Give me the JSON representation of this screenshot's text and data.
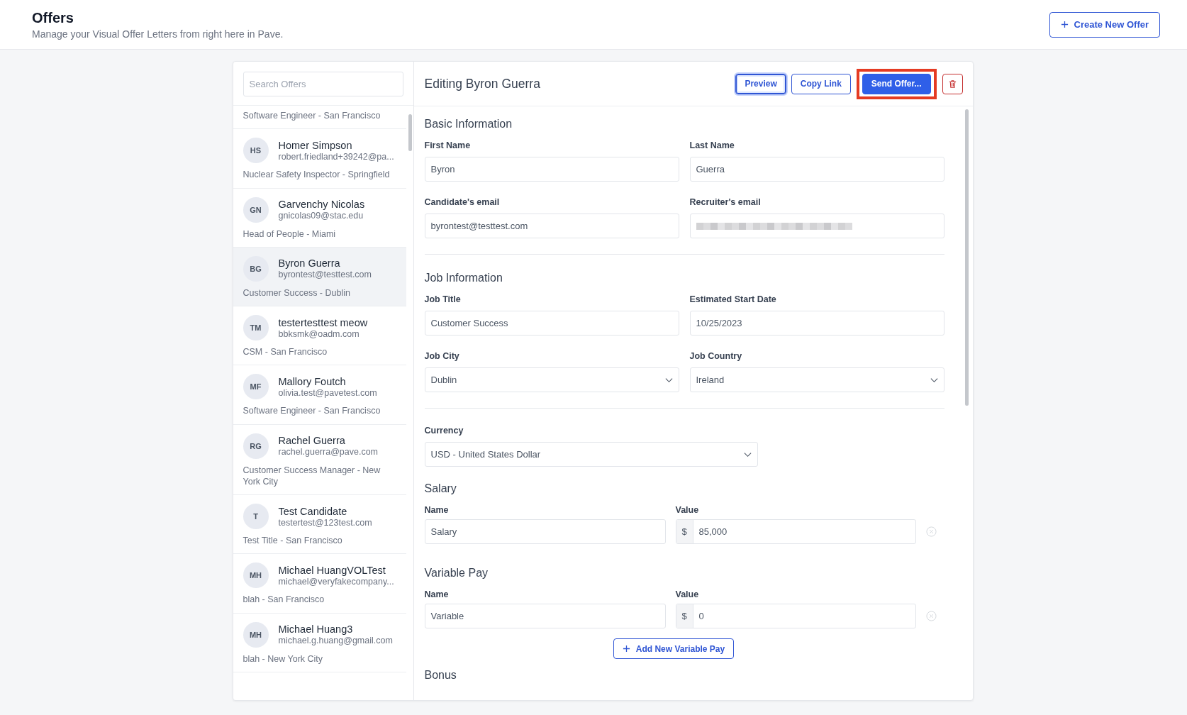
{
  "header": {
    "title": "Offers",
    "subtitle": "Manage your Visual Offer Letters from right here in Pave.",
    "create_button": "Create New Offer"
  },
  "search": {
    "placeholder": "Search Offers"
  },
  "offers": [
    {
      "kind": "partial",
      "role": "Software Engineer - San Francisco",
      "selected": false
    },
    {
      "kind": "full",
      "initials": "HS",
      "name": "Homer Simpson",
      "email": "robert.friedland+39242@pa...",
      "role": "Nuclear Safety Inspector - Springfield",
      "selected": false
    },
    {
      "kind": "full",
      "initials": "GN",
      "name": "Garvenchy Nicolas",
      "email": "gnicolas09@stac.edu",
      "role": "Head of People - Miami",
      "selected": false
    },
    {
      "kind": "full",
      "initials": "BG",
      "name": "Byron Guerra",
      "email": "byrontest@testtest.com",
      "role": "Customer Success - Dublin",
      "selected": true
    },
    {
      "kind": "full",
      "initials": "TM",
      "name": "testertesttest meow",
      "email": "bbksmk@oadm.com",
      "role": "CSM - San Francisco",
      "selected": false
    },
    {
      "kind": "full",
      "initials": "MF",
      "name": "Mallory Foutch",
      "email": "olivia.test@pavetest.com",
      "role": "Software Engineer - San Francisco",
      "selected": false
    },
    {
      "kind": "full",
      "initials": "RG",
      "name": "Rachel Guerra",
      "email": "rachel.guerra@pave.com",
      "role": "Customer Success Manager - New York City",
      "selected": false
    },
    {
      "kind": "full",
      "initials": "T",
      "name": "Test Candidate",
      "email": "testertest@123test.com",
      "role": "Test Title - San Francisco",
      "selected": false
    },
    {
      "kind": "full",
      "initials": "MH",
      "name": "Michael HuangVOLTest",
      "email": "michael@veryfakecompany...",
      "role": "blah - San Francisco",
      "selected": false
    },
    {
      "kind": "full",
      "initials": "MH",
      "name": "Michael Huang3",
      "email": "michael.g.huang@gmail.com",
      "role": "blah - New York City",
      "selected": false
    }
  ],
  "editor": {
    "title": "Editing Byron Guerra",
    "buttons": [
      {
        "kind": "outline",
        "label": "Preview",
        "focused": true
      },
      {
        "kind": "outline",
        "label": "Copy Link",
        "focused": false
      },
      {
        "kind": "primary",
        "label": "Send Offer...",
        "highlighted": true
      },
      {
        "kind": "delete"
      }
    ],
    "sections": [
      {
        "heading": "Basic Information",
        "fields": [
          {
            "kind": "text",
            "label": "First Name",
            "value": "Byron"
          },
          {
            "kind": "text",
            "label": "Last Name",
            "value": "Guerra"
          },
          {
            "kind": "text",
            "label": "Candidate's email",
            "value": "byrontest@testtest.com"
          },
          {
            "kind": "redacted",
            "label": "Recruiter's email"
          }
        ]
      },
      {
        "heading": "Job Information",
        "fields": [
          {
            "kind": "text",
            "label": "Job Title",
            "value": "Customer Success"
          },
          {
            "kind": "text",
            "label": "Estimated Start Date",
            "value": "10/25/2023"
          },
          {
            "kind": "select",
            "label": "Job City",
            "value": "Dublin"
          },
          {
            "kind": "select",
            "label": "Job Country",
            "value": "Ireland"
          }
        ]
      }
    ],
    "currency": {
      "label": "Currency",
      "value": "USD - United States Dollar"
    },
    "salary": {
      "heading": "Salary",
      "name_label": "Name",
      "value_label": "Value",
      "rows": [
        {
          "name": "Salary",
          "symbol": "$",
          "value": "85,000"
        }
      ]
    },
    "variable_pay": {
      "heading": "Variable Pay",
      "name_label": "Name",
      "value_label": "Value",
      "rows": [
        {
          "name": "Variable",
          "symbol": "$",
          "value": "0"
        }
      ],
      "add_button": "Add New Variable Pay"
    },
    "bonus": {
      "heading": "Bonus"
    }
  }
}
